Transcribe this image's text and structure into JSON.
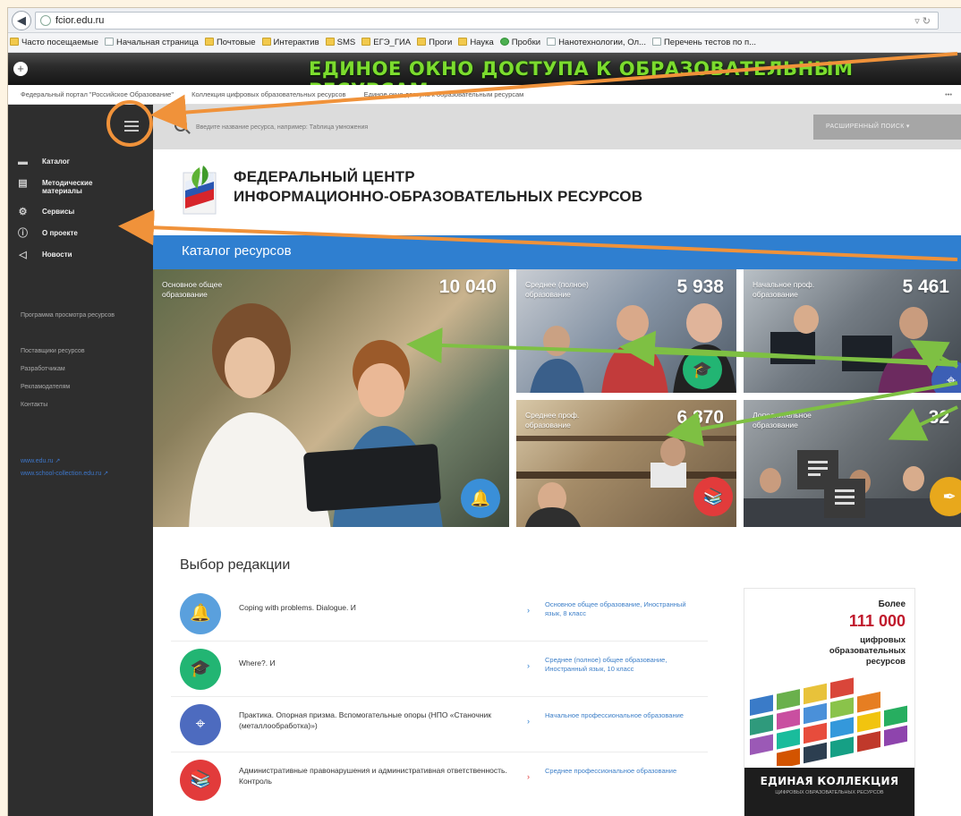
{
  "browser": {
    "url": "fcior.edu.ru",
    "bookmarks": [
      {
        "label": "Часто посещаемые",
        "icon": "folder-icon"
      },
      {
        "label": "Начальная страница",
        "icon": "page-icon"
      },
      {
        "label": "Почтовые",
        "icon": "folder-icon"
      },
      {
        "label": "Интерактив",
        "icon": "folder-icon"
      },
      {
        "label": "SMS",
        "icon": "folder-icon"
      },
      {
        "label": "ЕГЭ_ГИА",
        "icon": "folder-icon"
      },
      {
        "label": "Проги",
        "icon": "folder-icon"
      },
      {
        "label": "Наука",
        "icon": "folder-icon"
      },
      {
        "label": "Пробки",
        "icon": "globe-icon"
      },
      {
        "label": "Нанотехнологии, Ол...",
        "icon": "page-icon"
      },
      {
        "label": "Перечень тестов по п...",
        "icon": "page-icon"
      }
    ]
  },
  "banner": {
    "title": "ЕДИНОЕ ОКНО ДОСТУПА К ОБРАЗОВАТЕЛЬНЫМ РЕСУРСАМ"
  },
  "breadcrumbs": [
    "Федеральный портал \"Российское Образование\"",
    "Коллекция цифровых образовательных ресурсов",
    "Единое окно доступа к образовательным ресурсам"
  ],
  "sidebar": {
    "items": [
      {
        "label": "Каталог",
        "icon": "folder-icon"
      },
      {
        "label": "Методические материалы",
        "icon": "books-icon"
      },
      {
        "label": "Сервисы",
        "icon": "gear-icon"
      },
      {
        "label": "О проекте",
        "icon": "info-icon"
      },
      {
        "label": "Новости",
        "icon": "megaphone-icon"
      }
    ],
    "links": [
      "Программа просмотра ресурсов",
      "Поставщики ресурсов",
      "Разработчикам",
      "Рекламодателям",
      "Контакты"
    ],
    "external": [
      "www.edu.ru",
      "www.school-collection.edu.ru"
    ]
  },
  "search": {
    "placeholder": "Введите название ресурса, например: Таблица умножения",
    "advanced_label": "РАСШИРЕННЫЙ ПОИСК ▾"
  },
  "header": {
    "line1": "ФЕДЕРАЛЬНЫЙ ЦЕНТР",
    "line2": "ИНФОРМАЦИОННО-ОБРАЗОВАТЕЛЬНЫХ РЕСУРСОВ"
  },
  "catalog": {
    "title": "Каталог ресурсов",
    "tiles": [
      {
        "label": "Основное общее образование",
        "count": "10 040",
        "badge_color": "#3a8fd8",
        "icon": "bell-icon"
      },
      {
        "label": "Среднее (полное) образование",
        "count": "5 938",
        "badge_color": "#22b573",
        "icon": "graduation-cap-icon"
      },
      {
        "label": "Начальное проф. образование",
        "count": "5 461",
        "badge_color": "#3c5fb5",
        "icon": "compass-icon"
      },
      {
        "label": "Среднее проф. образование",
        "count": "6 870",
        "badge_color": "#e23b3b",
        "icon": "books-icon"
      },
      {
        "label": "Дополнительное образование",
        "count": "32",
        "badge_color": "#e8a81c",
        "icon": "quill-icon"
      }
    ]
  },
  "editor": {
    "title": "Выбор редакции",
    "rows": [
      {
        "text": "Coping with problems. Dialogue. И",
        "category": "Основное общее образование, Иностранный язык, 8 класс",
        "color": "#5aa0dd",
        "icon": "bell-icon",
        "arrow": "›"
      },
      {
        "text": "Where?. И",
        "category": "Среднее (полное) общее образование, Иностранный язык, 10 класс",
        "color": "#22b573",
        "icon": "graduation-cap-icon",
        "arrow": "›"
      },
      {
        "text": "Практика. Опорная призма. Вспомогательные опоры (НПО «Станочник (металлообработка)»)",
        "category": "Начальное профессиональное образование",
        "color": "#4d6bbf",
        "icon": "compass-icon",
        "arrow": "›"
      },
      {
        "text": "Административные правонарушения и административная ответственность. Контроль",
        "category": "Среднее профессиональное образование",
        "color": "#e23b3b",
        "icon": "books-icon",
        "arrow": "›"
      }
    ]
  },
  "ad": {
    "more": "Более",
    "count": "111 000",
    "desc": "цифровых образовательных ресурсов",
    "collection_title": "ЕДИНАЯ КОЛЛЕКЦИЯ",
    "collection_sub": "ЦИФРОВЫХ ОБРАЗОВАТЕЛЬНЫХ РЕСУРСОВ"
  },
  "colors": {
    "accent": "#2f7fd0",
    "sidebar": "#2e2e2e",
    "annotation_orange": "#f0923a",
    "annotation_green": "#7ec043"
  }
}
